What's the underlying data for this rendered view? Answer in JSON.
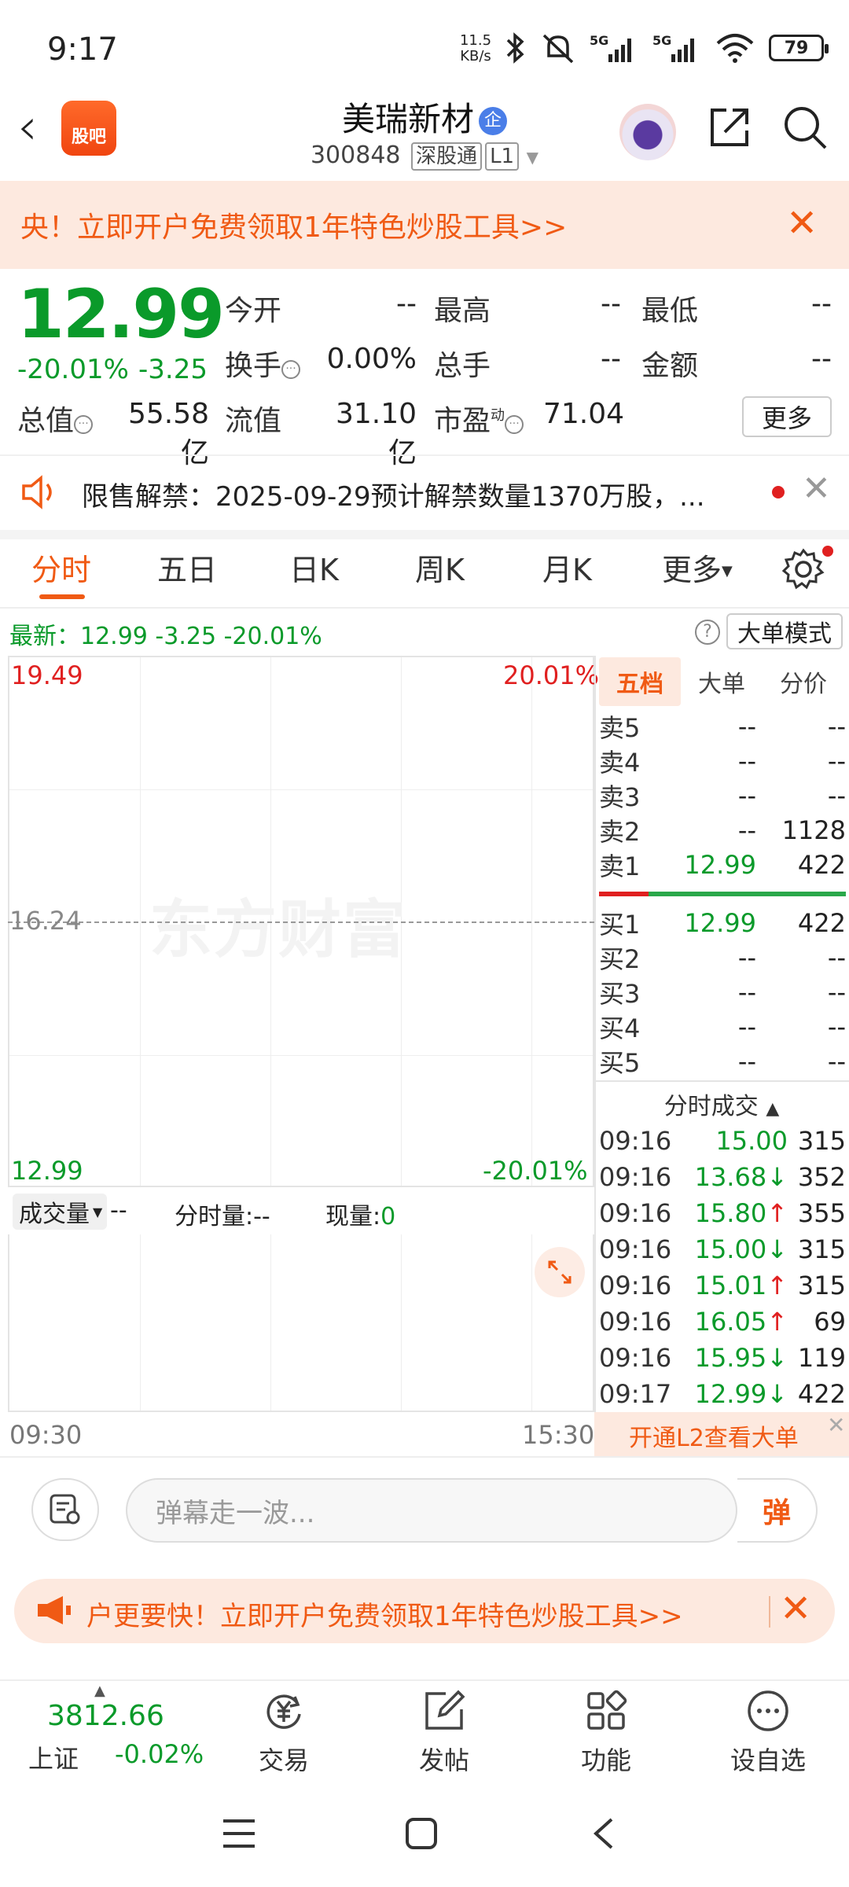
{
  "status_bar": {
    "time": "9:17",
    "net_speed_value": "11.5",
    "net_speed_unit": "KB/s",
    "battery": "79",
    "icons": [
      "bluetooth-icon",
      "mute-icon",
      "signal-5g-icon",
      "signal-5g-icon",
      "wifi-icon",
      "battery-icon"
    ]
  },
  "header": {
    "logo_label": "股吧",
    "stock_name": "美瑞新材",
    "badge": "企",
    "stock_code": "300848",
    "tag_connect": "深股通",
    "tag_level": "L1"
  },
  "promo_top": {
    "text": "央！立即开户免费领取1年特色炒股工具>>",
    "close": "✕"
  },
  "quote": {
    "price": "12.99",
    "change_pct": "-20.01%",
    "change_amt": "-3.25",
    "fields": [
      {
        "label": "今开",
        "value": "--"
      },
      {
        "label": "最高",
        "value": "--"
      },
      {
        "label": "最低",
        "value": "--"
      },
      {
        "label": "换手",
        "value": "0.00%"
      },
      {
        "label": "总手",
        "value": "--"
      },
      {
        "label": "金额",
        "value": "--"
      },
      {
        "label": "总值",
        "value": "55.58亿"
      },
      {
        "label": "流值",
        "value": "31.10亿"
      },
      {
        "label": "市盈",
        "value": "71.04"
      }
    ],
    "pe_superscript": "动",
    "more_label": "更多"
  },
  "notice": {
    "text": "限售解禁：2025-09-29预计解禁数量1370万股，...",
    "close": "✕"
  },
  "tabs": [
    "分时",
    "五日",
    "日K",
    "周K",
    "月K",
    "更多"
  ],
  "latest": {
    "text": "最新：12.99   -3.25   -20.01%",
    "help": "?",
    "mode_label": "大单模式"
  },
  "chart": {
    "y_high": "19.49",
    "y_high_pct": "20.01%",
    "y_mid": "16.24",
    "y_low": "12.99",
    "y_low_pct": "-20.01%",
    "watermark": "东方财富",
    "vol_select": "成交量",
    "vol_a": "--",
    "vol_b": "分时量:--",
    "vol_c_label": "现量:",
    "vol_c_value": "0",
    "time_start": "09:30",
    "time_end": "15:30"
  },
  "order_book": {
    "tabs": [
      "五档",
      "大单",
      "分价"
    ],
    "asks": [
      {
        "label": "卖5",
        "price": "--",
        "volume": "--"
      },
      {
        "label": "卖4",
        "price": "--",
        "volume": "--"
      },
      {
        "label": "卖3",
        "price": "--",
        "volume": "--"
      },
      {
        "label": "卖2",
        "price": "--",
        "volume": "1128"
      },
      {
        "label": "卖1",
        "price": "12.99",
        "volume": "422"
      }
    ],
    "bids": [
      {
        "label": "买1",
        "price": "12.99",
        "volume": "422"
      },
      {
        "label": "买2",
        "price": "--",
        "volume": "--"
      },
      {
        "label": "买3",
        "price": "--",
        "volume": "--"
      },
      {
        "label": "买4",
        "price": "--",
        "volume": "--"
      },
      {
        "label": "买5",
        "price": "--",
        "volume": "--"
      }
    ],
    "ratio_bar": {
      "sell_fraction": 0.2,
      "buy_fraction": 0.8
    }
  },
  "time_trades": {
    "title": "分时成交",
    "rows": [
      {
        "time": "09:16",
        "price": "15.00",
        "dir": "",
        "volume": "315"
      },
      {
        "time": "09:16",
        "price": "13.68",
        "dir": "↓",
        "volume": "352"
      },
      {
        "time": "09:16",
        "price": "15.80",
        "dir": "↑",
        "volume": "355"
      },
      {
        "time": "09:16",
        "price": "15.00",
        "dir": "↓",
        "volume": "315"
      },
      {
        "time": "09:16",
        "price": "15.01",
        "dir": "↑",
        "volume": "315"
      },
      {
        "time": "09:16",
        "price": "16.05",
        "dir": "↑",
        "volume": "69"
      },
      {
        "time": "09:16",
        "price": "15.95",
        "dir": "↓",
        "volume": "119"
      },
      {
        "time": "09:17",
        "price": "12.99",
        "dir": "↓",
        "volume": "422"
      }
    ],
    "l2_label": "开通L2查看大单"
  },
  "comment": {
    "placeholder": "弹幕走一波...",
    "danmu_label": "弹"
  },
  "promo_bottom": {
    "text": "户更要快！立即开户免费领取1年特色炒股工具>>",
    "close": "✕"
  },
  "bottom_nav": {
    "index_value": "3812.66",
    "index_name": "上证",
    "index_change": "-0.02%",
    "items": [
      {
        "label": "交易",
        "icon": "yen-cycle-icon"
      },
      {
        "label": "发帖",
        "icon": "edit-icon"
      },
      {
        "label": "功能",
        "icon": "grid-icon"
      },
      {
        "label": "设自选",
        "icon": "more-dots-icon"
      }
    ]
  }
}
